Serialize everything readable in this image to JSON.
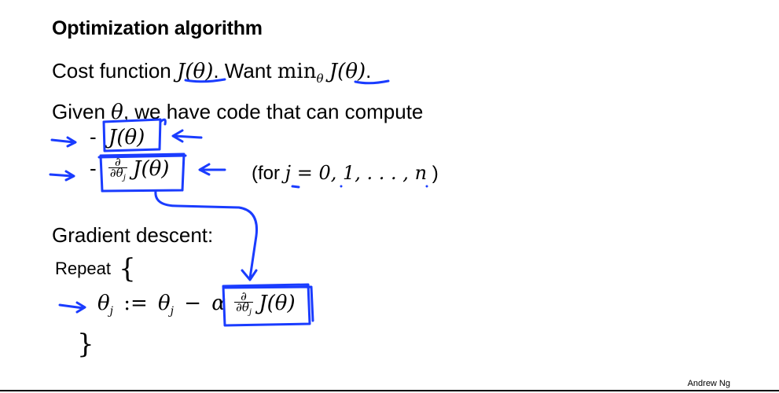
{
  "slide": {
    "title": "Optimization algorithm",
    "cost_prefix": "Cost function",
    "cost_expr": "J(θ)",
    "want_prefix": ". Want",
    "min_op": "min",
    "min_sub": "θ",
    "min_expr": "J(θ)",
    "period": ".",
    "given_prefix": "Given",
    "given_var": "θ",
    "given_suffix": ", we have code that can compute",
    "bullet_dash": "-",
    "item1_expr": "J(θ)",
    "item2_num": "∂",
    "item2_den": "∂θ",
    "item2_den_sub": "j",
    "item2_expr": "J(θ)",
    "for_open": "(for",
    "for_expr": "j = 0, 1, . . . , n",
    "for_close": ")",
    "gd_label": "Gradient descent:",
    "repeat_label": "Repeat",
    "open_brace": "{",
    "update_lhs_var": "θ",
    "update_lhs_sub": "j",
    "update_assign": ":=",
    "update_rhs_var": "θ",
    "update_rhs_sub": "j",
    "update_minus": "−",
    "update_alpha": "α",
    "update_num": "∂",
    "update_den": "∂θ",
    "update_den_sub": "j",
    "update_expr": "J(θ)",
    "close_brace": "}",
    "author": "Andrew Ng"
  },
  "colors": {
    "ink": "#1a3cff",
    "text": "#000000",
    "background": "#ffffff"
  }
}
